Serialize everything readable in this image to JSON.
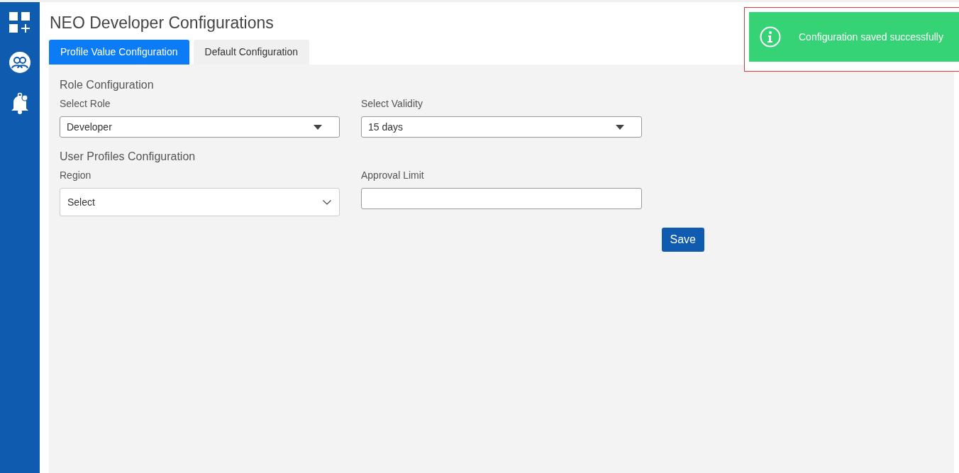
{
  "sidebar": {
    "items": [
      {
        "kind": "apps"
      },
      {
        "kind": "users"
      },
      {
        "kind": "bell"
      }
    ]
  },
  "title": "NEO Developer Configurations",
  "tabs": [
    {
      "label": "Profile Value Configuration",
      "selected": true
    },
    {
      "label": "Default Configuration",
      "selected": false
    }
  ],
  "sections": [
    {
      "heading": "Role Configuration",
      "fields": [
        {
          "label": "Select Role",
          "kind": "dropdown",
          "value": "Developer"
        },
        {
          "label": "Select Validity",
          "kind": "dropdown",
          "value": "15 days"
        }
      ]
    },
    {
      "heading": "User Profiles Configuration",
      "fields": [
        {
          "label": "Region",
          "kind": "select",
          "value": "Select"
        },
        {
          "label": "Approval Limit",
          "kind": "input"
        }
      ]
    }
  ],
  "save_button": "Save",
  "toast": {
    "message": "Configuration saved successfully"
  }
}
